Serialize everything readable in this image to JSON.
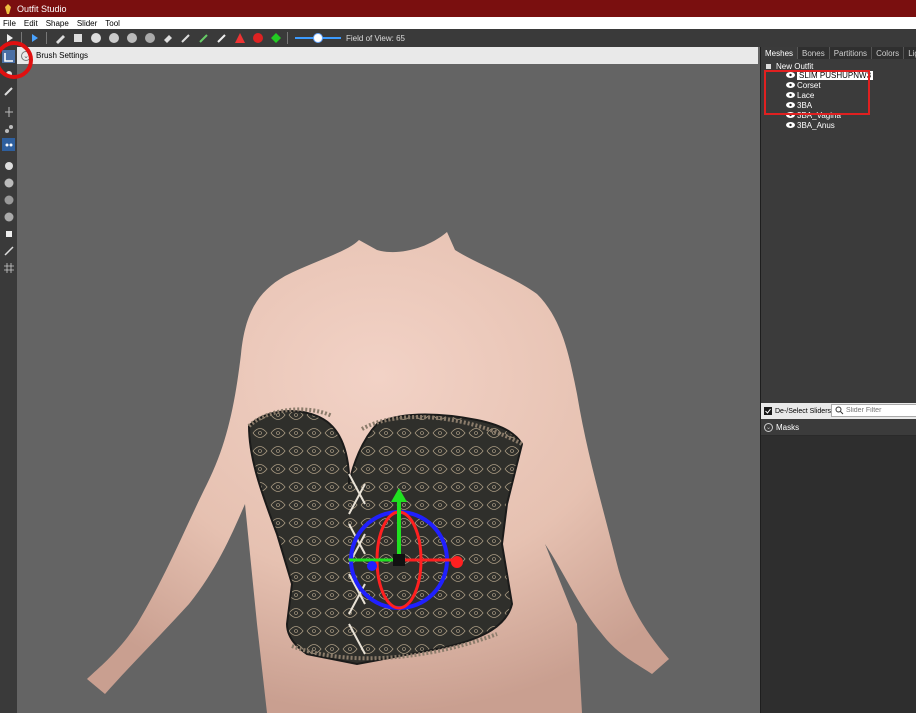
{
  "window": {
    "title": "Outfit Studio"
  },
  "menu": [
    "File",
    "Edit",
    "Shape",
    "Slider",
    "Tool"
  ],
  "toolbar": {
    "fov_label": "Field of View: 65",
    "fov_value": 65
  },
  "brush_bar": {
    "label": "Brush Settings"
  },
  "meshes_panel": {
    "tabs": [
      "Meshes",
      "Bones",
      "Partitions",
      "Colors",
      "Lights"
    ],
    "active_tab": "Meshes",
    "root": "New Outfit",
    "items": [
      {
        "label": "SLIM PUSHUPNW3",
        "selected": true
      },
      {
        "label": "Corset",
        "selected": false
      },
      {
        "label": "Lace",
        "selected": false
      },
      {
        "label": "3BA",
        "selected": false
      },
      {
        "label": "3BA_Vagina",
        "selected": false
      },
      {
        "label": "3BA_Anus",
        "selected": false
      }
    ]
  },
  "sliders_panel": {
    "deselect_label": "De-/Select Sliders",
    "filter_placeholder": "Slider Filter",
    "masks_label": "Masks"
  },
  "colors": {
    "titlebar": "#7a0f0f",
    "highlight_red": "#e02020",
    "gizmo_red": "#ff2020",
    "gizmo_green": "#20e020",
    "gizmo_blue": "#2020ff"
  }
}
